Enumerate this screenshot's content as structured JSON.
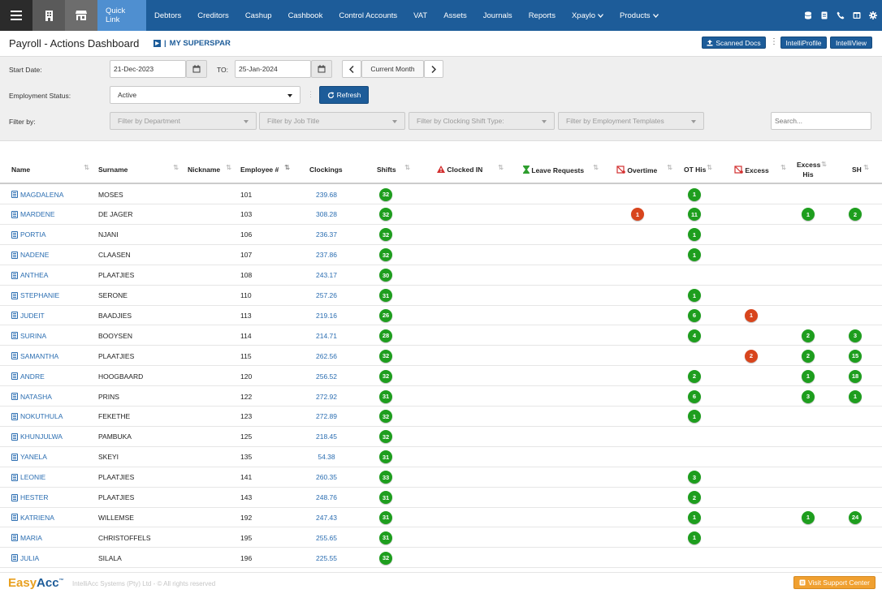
{
  "nav": {
    "items": [
      {
        "label": "Quick Link",
        "active": true
      },
      {
        "label": "Debtors"
      },
      {
        "label": "Creditors"
      },
      {
        "label": "Cashup"
      },
      {
        "label": "Cashbook"
      },
      {
        "label": "Control Accounts"
      },
      {
        "label": "VAT"
      },
      {
        "label": "Assets"
      },
      {
        "label": "Journals"
      },
      {
        "label": "Reports"
      },
      {
        "label": "Xpaylo"
      },
      {
        "label": "Products"
      }
    ],
    "right_icons": [
      "database-icon",
      "document-icon",
      "phone-icon",
      "window-icon",
      "gear-icon"
    ]
  },
  "header": {
    "title": "Payroll - Actions Dashboard",
    "company": "MY SUPERSPAR",
    "scanned_docs": "Scanned Docs",
    "intelliprofile": "IntelliProfile",
    "intelliview": "IntelliView"
  },
  "filters": {
    "start_label": "Start Date:",
    "start_value": "21-Dec-2023",
    "to_label": "TO:",
    "end_value": "25-Jan-2024",
    "period_label": "Current Month",
    "employment_label": "Employment Status:",
    "employment_value": "Active",
    "refresh_label": "Refresh",
    "filter_label": "Filter by:",
    "department_placeholder": "Filter by Department",
    "jobtitle_placeholder": "Filter by Job Title",
    "shifttype_placeholder": "Filter by Clocking Shift Type:",
    "templates_placeholder": "Filter by Employment Templates",
    "search_placeholder": "Search..."
  },
  "table": {
    "columns": {
      "name": "Name",
      "surname": "Surname",
      "nickname": "Nickname",
      "employee": "Employee #",
      "clockings": "Clockings",
      "shifts": "Shifts",
      "clocked_in": "Clocked IN",
      "leave": "Leave Requests",
      "overtime": "Overtime",
      "ot_his": "OT His",
      "excess": "Excess",
      "excess_his_1": "Excess",
      "excess_his_2": "His",
      "sh": "SH"
    },
    "rows": [
      {
        "name": "MAGDALENA",
        "surname": "MOSES",
        "emp": "101",
        "clockings": "239.68",
        "shifts": "32",
        "overtime": "",
        "ot_his": "1",
        "excess": "",
        "excess_his": "",
        "sh": ""
      },
      {
        "name": "MARDENE",
        "surname": "DE JAGER",
        "emp": "103",
        "clockings": "308.28",
        "shifts": "32",
        "overtime": "1",
        "ot_his": "11",
        "excess": "",
        "excess_his": "1",
        "sh": "2"
      },
      {
        "name": "PORTIA",
        "surname": "NJANI",
        "emp": "106",
        "clockings": "236.37",
        "shifts": "32",
        "overtime": "",
        "ot_his": "1",
        "excess": "",
        "excess_his": "",
        "sh": ""
      },
      {
        "name": "NADENE",
        "surname": "CLAASEN",
        "emp": "107",
        "clockings": "237.86",
        "shifts": "32",
        "overtime": "",
        "ot_his": "1",
        "excess": "",
        "excess_his": "",
        "sh": ""
      },
      {
        "name": "ANTHEA",
        "surname": "PLAATJIES",
        "emp": "108",
        "clockings": "243.17",
        "shifts": "30",
        "overtime": "",
        "ot_his": "",
        "excess": "",
        "excess_his": "",
        "sh": ""
      },
      {
        "name": "STEPHANIE",
        "surname": "SERONE",
        "emp": "110",
        "clockings": "257.26",
        "shifts": "31",
        "overtime": "",
        "ot_his": "1",
        "excess": "",
        "excess_his": "",
        "sh": ""
      },
      {
        "name": "JUDEIT",
        "surname": "BAADJIES",
        "emp": "113",
        "clockings": "219.16",
        "shifts": "26",
        "overtime": "",
        "ot_his": "6",
        "excess": "1",
        "excess_his": "",
        "sh": ""
      },
      {
        "name": "SURINA",
        "surname": "BOOYSEN",
        "emp": "114",
        "clockings": "214.71",
        "shifts": "28",
        "overtime": "",
        "ot_his": "4",
        "excess": "",
        "excess_his": "2",
        "sh": "3"
      },
      {
        "name": "SAMANTHA",
        "surname": "PLAATJIES",
        "emp": "115",
        "clockings": "262.56",
        "shifts": "32",
        "overtime": "",
        "ot_his": "",
        "excess": "2",
        "excess_his": "2",
        "sh": "15"
      },
      {
        "name": "ANDRE",
        "surname": "HOOGBAARD",
        "emp": "120",
        "clockings": "256.52",
        "shifts": "32",
        "overtime": "",
        "ot_his": "2",
        "excess": "",
        "excess_his": "1",
        "sh": "18"
      },
      {
        "name": "NATASHA",
        "surname": "PRINS",
        "emp": "122",
        "clockings": "272.92",
        "shifts": "31",
        "overtime": "",
        "ot_his": "6",
        "excess": "",
        "excess_his": "3",
        "sh": "1"
      },
      {
        "name": "NOKUTHULA",
        "surname": "FEKETHE",
        "emp": "123",
        "clockings": "272.89",
        "shifts": "32",
        "overtime": "",
        "ot_his": "1",
        "excess": "",
        "excess_his": "",
        "sh": ""
      },
      {
        "name": "KHUNJULWA",
        "surname": "PAMBUKA",
        "emp": "125",
        "clockings": "218.45",
        "shifts": "32",
        "overtime": "",
        "ot_his": "",
        "excess": "",
        "excess_his": "",
        "sh": ""
      },
      {
        "name": "YANELA",
        "surname": "SKEYI",
        "emp": "135",
        "clockings": "54.38",
        "shifts": "31",
        "overtime": "",
        "ot_his": "",
        "excess": "",
        "excess_his": "",
        "sh": ""
      },
      {
        "name": "LEONIE",
        "surname": "PLAATJIES",
        "emp": "141",
        "clockings": "260.35",
        "shifts": "33",
        "overtime": "",
        "ot_his": "3",
        "excess": "",
        "excess_his": "",
        "sh": ""
      },
      {
        "name": "HESTER",
        "surname": "PLAATJIES",
        "emp": "143",
        "clockings": "248.76",
        "shifts": "31",
        "overtime": "",
        "ot_his": "2",
        "excess": "",
        "excess_his": "",
        "sh": ""
      },
      {
        "name": "KATRIENA",
        "surname": "WILLEMSE",
        "emp": "192",
        "clockings": "247.43",
        "shifts": "31",
        "overtime": "",
        "ot_his": "1",
        "excess": "",
        "excess_his": "1",
        "sh": "24"
      },
      {
        "name": "MARIA",
        "surname": "CHRISTOFFELS",
        "emp": "195",
        "clockings": "255.65",
        "shifts": "31",
        "overtime": "",
        "ot_his": "1",
        "excess": "",
        "excess_his": "",
        "sh": ""
      },
      {
        "name": "JULIA",
        "surname": "SILALA",
        "emp": "196",
        "clockings": "225.55",
        "shifts": "32",
        "overtime": "",
        "ot_his": "",
        "excess": "",
        "excess_his": "",
        "sh": ""
      }
    ]
  },
  "footer": {
    "logo_a": "Easy",
    "logo_b": "Acc",
    "logo_tm": "™",
    "copyright": "IntelliAcc Systems (Pty) Ltd - © All rights reserved",
    "support": "Visit Support Center"
  },
  "colors": {
    "nav_bg": "#1d5c99",
    "nav_active": "#4f8fd0",
    "badge_green": "#1e9e1e",
    "badge_red": "#d8451d",
    "link": "#2a6db1",
    "support_btn": "#f0a030"
  }
}
